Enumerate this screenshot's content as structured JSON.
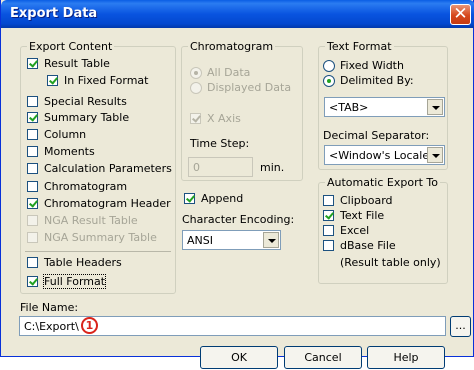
{
  "window": {
    "title": "Export Data"
  },
  "export_content": {
    "legend": "Export Content",
    "items": [
      {
        "label": "Result Table",
        "checked": true,
        "enabled": true
      },
      {
        "label": "In Fixed Format",
        "checked": true,
        "enabled": true
      },
      {
        "label": "Special Results",
        "checked": false,
        "enabled": true
      },
      {
        "label": "Summary Table",
        "checked": true,
        "enabled": true
      },
      {
        "label": "Column",
        "checked": false,
        "enabled": true
      },
      {
        "label": "Moments",
        "checked": false,
        "enabled": true
      },
      {
        "label": "Calculation Parameters",
        "checked": false,
        "enabled": true
      },
      {
        "label": "Chromatogram",
        "checked": false,
        "enabled": true
      },
      {
        "label": "Chromatogram Header",
        "checked": true,
        "enabled": true
      },
      {
        "label": "NGA Result Table",
        "checked": false,
        "enabled": false
      },
      {
        "label": "NGA Summary Table",
        "checked": false,
        "enabled": false
      }
    ],
    "table_headers": {
      "label": "Table Headers",
      "checked": false
    },
    "full_format": {
      "label": "Full Format",
      "checked": true
    }
  },
  "chromatogram": {
    "legend": "Chromatogram",
    "all_data": "All Data",
    "displayed_data": "Displayed Data",
    "x_axis": "X Axis",
    "time_step_label": "Time Step:",
    "time_step_value": "0",
    "time_step_unit": "min."
  },
  "append": {
    "label": "Append",
    "checked": true
  },
  "encoding": {
    "label": "Character Encoding:",
    "value": "ANSI"
  },
  "text_format": {
    "legend": "Text Format",
    "fixed_width": "Fixed Width",
    "delimited_by": "Delimited By:",
    "delimiter_value": "<TAB>",
    "decimal_separator_label": "Decimal Separator:",
    "decimal_separator_value": "<Window's Locale>"
  },
  "auto_export": {
    "legend": "Automatic Export To",
    "items": [
      {
        "label": "Clipboard",
        "checked": false
      },
      {
        "label": "Text File",
        "checked": true
      },
      {
        "label": "Excel",
        "checked": false
      },
      {
        "label": "dBase File",
        "checked": false
      }
    ],
    "note": "(Result table only)"
  },
  "file_name": {
    "label": "File Name:",
    "value": "C:\\Export\\",
    "browse_label": "..."
  },
  "callout": "1",
  "buttons": {
    "ok": "OK",
    "cancel": "Cancel",
    "help": "Help"
  }
}
